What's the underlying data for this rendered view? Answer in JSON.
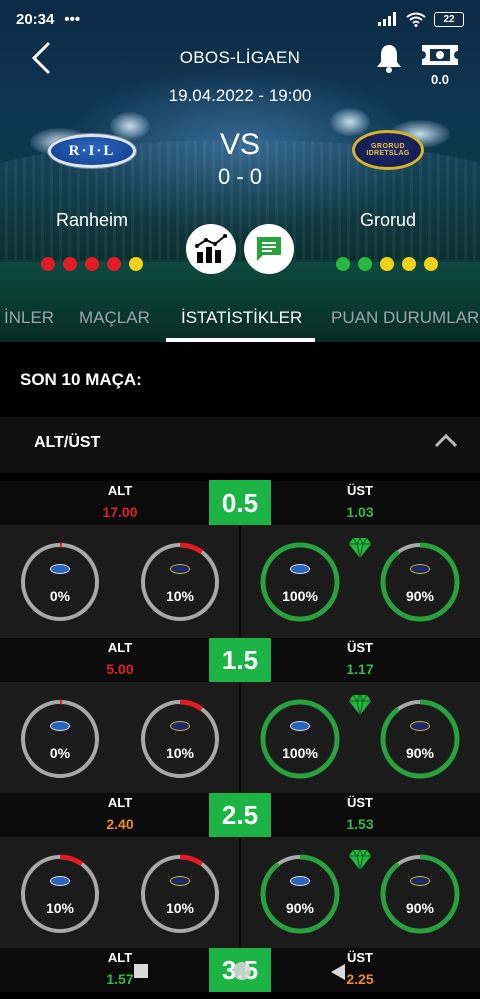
{
  "status": {
    "time": "20:34",
    "dots": "•••",
    "battery": "22"
  },
  "header": {
    "league": "OBOS-LİGAEN",
    "datetime": "19.04.2022 - 19:00",
    "vs": "VS",
    "score": "0 - 0",
    "ticket_count": "0.0"
  },
  "home": {
    "name": "Ranheim",
    "logo_text": "R·I·L",
    "form": [
      "#e01c24",
      "#e01c24",
      "#e01c24",
      "#e01c24",
      "#f2d21b"
    ]
  },
  "away": {
    "name": "Grorud",
    "logo_top": "GRORUD",
    "logo_bottom": "IDRETSLAG",
    "form": [
      "#27b83f",
      "#27b83f",
      "#f2d21b",
      "#f2d21b",
      "#f2d21b"
    ]
  },
  "tabs": [
    "İNLER",
    "MAÇLAR",
    "İSTATİSTİKLER",
    "PUAN DURUMLARI"
  ],
  "section_title": "SON 10 MAÇA:",
  "altust": {
    "title": "ALT/ÜST",
    "under_label": "ALT",
    "over_label": "ÜST",
    "lines": [
      {
        "line": "0.5",
        "under_odds": "17.00",
        "under_color": "#e0202b",
        "over_odds": "1.03",
        "over_color": "#34b94c",
        "rings": [
          {
            "pct_label": "0%",
            "value": 0,
            "color": "#e01c24"
          },
          {
            "pct_label": "10%",
            "value": 10,
            "color": "#e01c24"
          },
          {
            "pct_label": "100%",
            "value": 100,
            "color": "#27a23c"
          },
          {
            "pct_label": "90%",
            "value": 90,
            "color": "#27a23c"
          }
        ]
      },
      {
        "line": "1.5",
        "under_odds": "5.00",
        "under_color": "#e0202b",
        "over_odds": "1.17",
        "over_color": "#34b94c",
        "rings": [
          {
            "pct_label": "0%",
            "value": 0,
            "color": "#e01c24"
          },
          {
            "pct_label": "10%",
            "value": 10,
            "color": "#e01c24"
          },
          {
            "pct_label": "100%",
            "value": 100,
            "color": "#27a23c"
          },
          {
            "pct_label": "90%",
            "value": 90,
            "color": "#27a23c"
          }
        ]
      },
      {
        "line": "2.5",
        "under_odds": "2.40",
        "under_color": "#f08a2c",
        "over_odds": "1.53",
        "over_color": "#34b94c",
        "rings": [
          {
            "pct_label": "10%",
            "value": 10,
            "color": "#e01c24"
          },
          {
            "pct_label": "10%",
            "value": 10,
            "color": "#e01c24"
          },
          {
            "pct_label": "90%",
            "value": 90,
            "color": "#27a23c"
          },
          {
            "pct_label": "90%",
            "value": 90,
            "color": "#27a23c"
          }
        ]
      },
      {
        "line": "3.5",
        "under_odds": "1.57",
        "under_color": "#34b94c",
        "over_odds": "2.25",
        "over_color": "#f08a2c"
      }
    ]
  }
}
